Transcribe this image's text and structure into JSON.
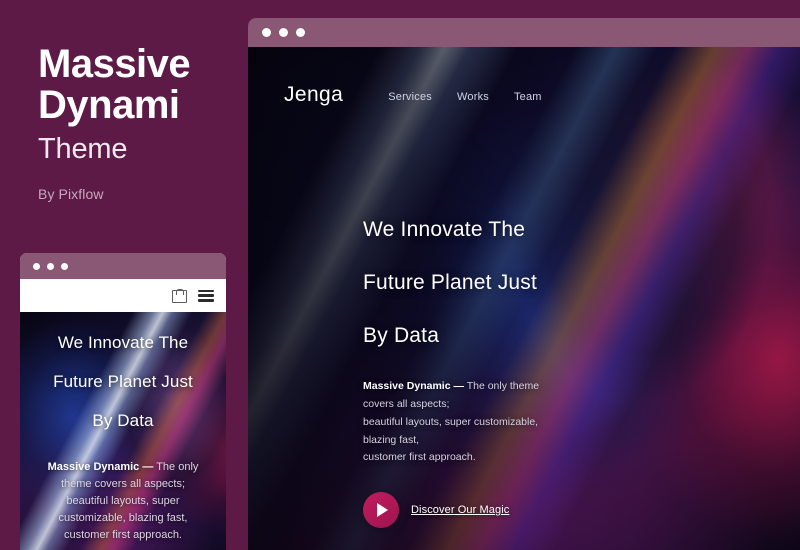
{
  "promo": {
    "title_line1": "Massive",
    "title_line2": "Dynami",
    "subtitle": "Theme",
    "author": "By Pixflow"
  },
  "small_mockup": {
    "nav": {
      "bag_icon": "shopping-bag-icon",
      "menu_icon": "hamburger-menu-icon"
    },
    "hero": {
      "line1": "We Innovate The",
      "line2": "Future Planet Just",
      "line3": "By Data",
      "para_bold": "Massive Dynamic —",
      "para_line1": " The only",
      "para_line2": "theme covers all aspects;",
      "para_line3": "beautiful layouts, super",
      "para_line4": "customizable, blazing fast,",
      "para_line5": "customer first approach."
    }
  },
  "big_mockup": {
    "logo": "Jenga",
    "nav_links": [
      {
        "label": "Services"
      },
      {
        "label": "Works"
      },
      {
        "label": "Team"
      }
    ],
    "hero": {
      "line1": "We Innovate The",
      "line2": "Future Planet Just",
      "line3": "By Data",
      "para_bold": "Massive Dynamic —",
      "para_line1": " The only theme",
      "para_line2": "covers all aspects;",
      "para_line3": "beautiful layouts, super customizable,",
      "para_line4": "blazing fast,",
      "para_line5": "customer first approach."
    },
    "cta": {
      "play_icon": "play-icon",
      "link_label": "Discover Our Magic"
    }
  },
  "colors": {
    "page_background": "#5d1a46",
    "window_titlebar": "#8a5774",
    "accent_play": "#b01a5a",
    "title_text": "#ffffff"
  }
}
